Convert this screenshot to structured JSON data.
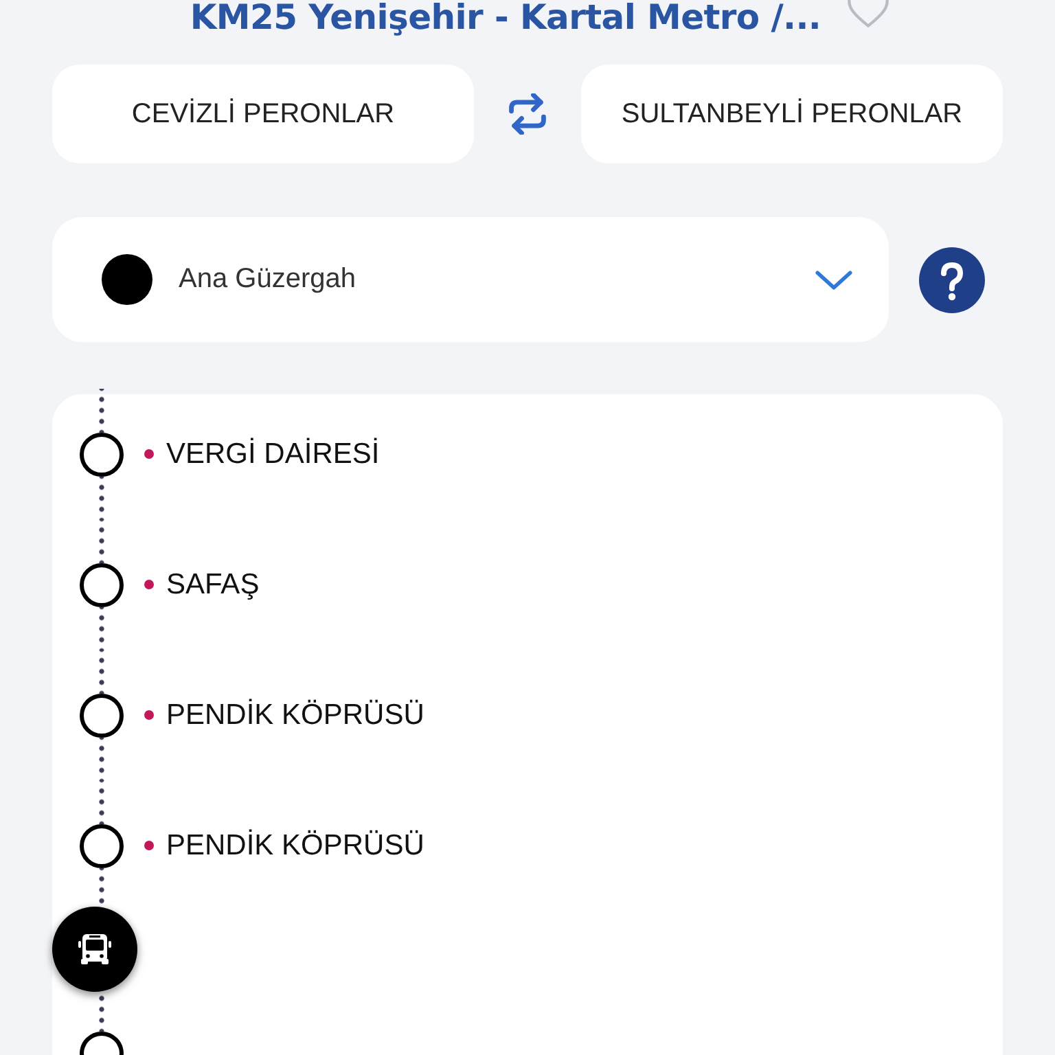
{
  "title": "KM25 Yenişehir - Kartal Metro /...",
  "favorite": false,
  "directions": [
    {
      "label": "CEVİZLİ PERONLAR",
      "selected": false
    },
    {
      "label": "SULTANBEYLİ PERONLAR",
      "selected": false
    }
  ],
  "route_select": {
    "value": "Ana Güzergah",
    "color": "#000000"
  },
  "stops": [
    {
      "kind": "stop",
      "name": "VERGİ DAİRESİ"
    },
    {
      "kind": "stop",
      "name": "SAFAŞ"
    },
    {
      "kind": "stop",
      "name": "PENDİK KÖPRÜSÜ"
    },
    {
      "kind": "stop",
      "name": "PENDİK KÖPRÜSÜ"
    },
    {
      "kind": "bus"
    },
    {
      "kind": "stop"
    }
  ]
}
